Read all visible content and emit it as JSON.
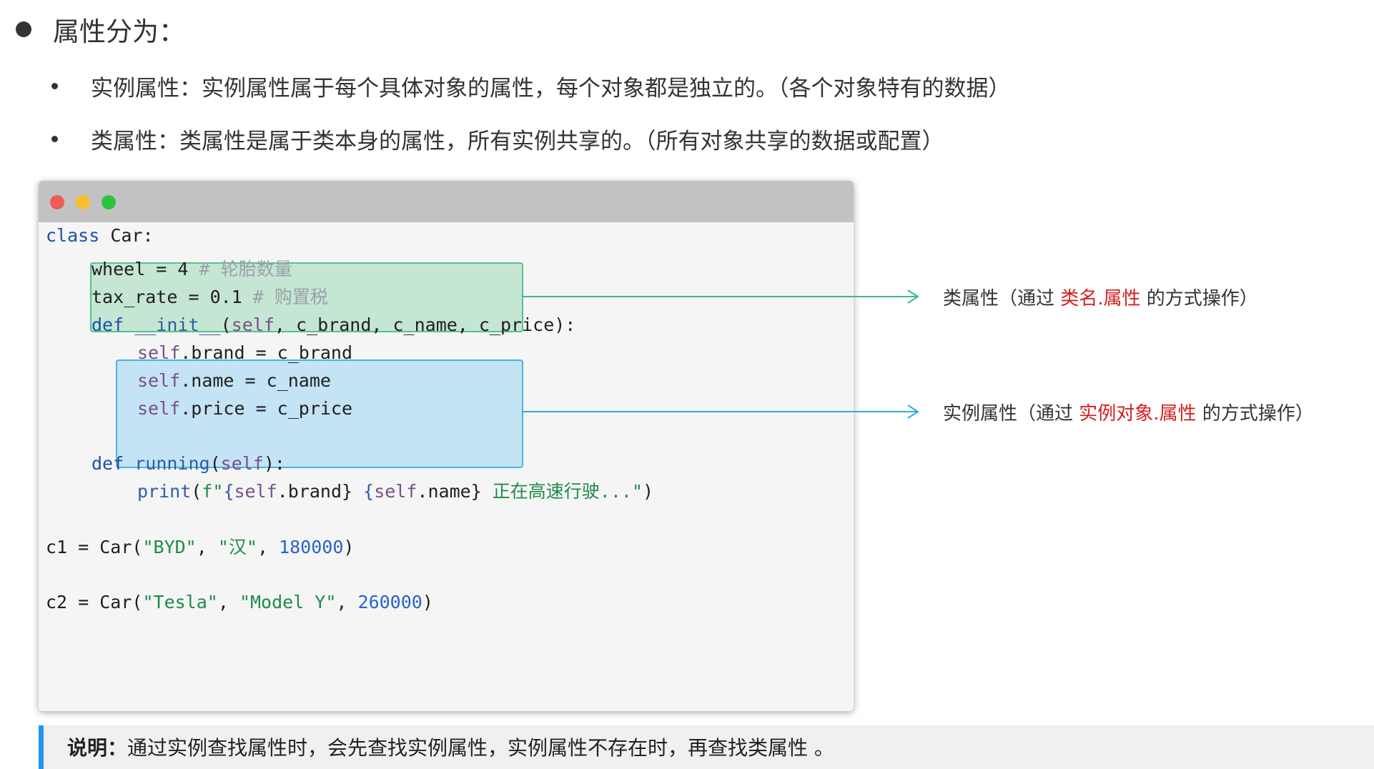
{
  "heading": "属性分为：",
  "bullets": [
    "实例属性：实例属性属于每个具体对象的属性，每个对象都是独立的。（各个对象特有的数据）",
    "类属性：类属性是属于类本身的属性，所有实例共享的。（所有对象共享的数据或配置）"
  ],
  "code": {
    "line1": {
      "kw": "class",
      "rest": " Car:"
    },
    "line2": {
      "code": "wheel = 4 ",
      "comment": "# 轮胎数量"
    },
    "line3": {
      "code": "tax_rate = 0.1 ",
      "comment": "# 购置税"
    },
    "line4": {
      "kw": "def",
      "fn": "__init__",
      "p1": "(",
      "self": "self",
      "rest": ", c_brand, c_name, c_price):"
    },
    "line5": {
      "self": "self",
      "rest": ".brand = c_brand"
    },
    "line6": {
      "self": "self",
      "rest": ".name = c_name"
    },
    "line7": {
      "self": "self",
      "rest": ".price = c_price"
    },
    "line8": {
      "kw": "def",
      "fn": "running",
      "p1": "(",
      "self": "self",
      "rest": "):"
    },
    "line9": {
      "fn": "print",
      "p1": "(",
      "fpre": "f\"",
      "b1": "{",
      "self1": "self",
      "b1rest": ".brand}",
      "sp": " ",
      "b2": "{",
      "self2": "self",
      "b2rest": ".name}",
      "strtail": " 正在高速行驶...\"",
      "close": ")"
    },
    "line10": {
      "pre": "c1 = Car(",
      "s1": "\"BYD\"",
      "c1": ", ",
      "s2": "\"汉\"",
      "c2": ", ",
      "n": "180000",
      "close": ")"
    },
    "line11": {
      "pre": "c2 = Car(",
      "s1": "\"Tesla\"",
      "c1": ", ",
      "s2": "\"Model Y\"",
      "c2": ", ",
      "n": "260000",
      "close": ")"
    }
  },
  "annotations": {
    "class_attr": {
      "pre": "类属性（通过 ",
      "red": "类名.属性",
      "post": " 的方式操作）"
    },
    "instance_attr": {
      "pre": "实例属性（通过 ",
      "red": "实例对象.属性",
      "post": " 的方式操作）"
    }
  },
  "note": {
    "bold": "说明：",
    "text": "通过实例查找属性时，会先查找实例属性，实例属性不存在时，再查找类属性 。"
  },
  "colors": {
    "green_box": "#c5e6d3",
    "blue_box": "#c4e3f4",
    "red_text": "#d41f1f",
    "accent_bar": "#2196f3"
  }
}
